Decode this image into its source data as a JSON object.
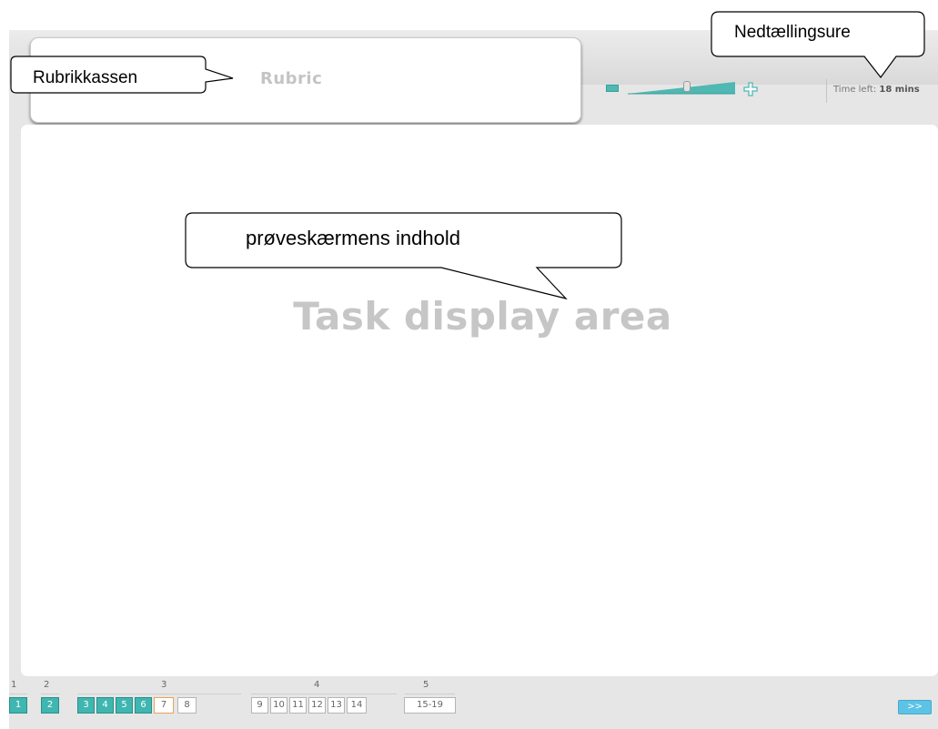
{
  "header": {
    "rubric_label": "Rubric",
    "time_left_prefix": "Time left:",
    "time_left_value": "18 mins"
  },
  "zoom": {
    "level": 0.55
  },
  "task": {
    "label": "Task display area"
  },
  "navigation": {
    "sections": [
      "1",
      "2",
      "3",
      "4",
      "5"
    ],
    "pages": [
      {
        "label": "1",
        "state": "done"
      },
      {
        "label": "2",
        "state": "done"
      },
      {
        "label": "3",
        "state": "done"
      },
      {
        "label": "4",
        "state": "done"
      },
      {
        "label": "5",
        "state": "done"
      },
      {
        "label": "6",
        "state": "done"
      },
      {
        "label": "7",
        "state": "current"
      },
      {
        "label": "8",
        "state": "todo"
      },
      {
        "label": "9",
        "state": "todo"
      },
      {
        "label": "10",
        "state": "todo"
      },
      {
        "label": "11",
        "state": "todo"
      },
      {
        "label": "12",
        "state": "todo"
      },
      {
        "label": "13",
        "state": "todo"
      },
      {
        "label": "14",
        "state": "todo"
      },
      {
        "label": "15-19",
        "state": "todo"
      }
    ],
    "next_label": ">>"
  },
  "callouts": {
    "rubric": "Rubrikkassen",
    "countdown": "Nedtællingsure",
    "content": "prøveskærmens indhold"
  },
  "colors": {
    "done": "#3fb6b0",
    "current_border": "#e8a25a",
    "next": "#5cc3e5",
    "accent": "#4fb8b3"
  }
}
